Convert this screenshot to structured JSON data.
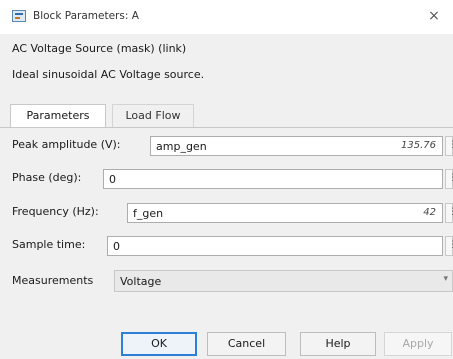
{
  "window": {
    "title": "Block Parameters: A",
    "close_glyph": "×",
    "icon": "simulink-block-icon"
  },
  "header": {
    "mask_title": "AC Voltage Source (mask) (link)",
    "description": "Ideal sinusoidal AC Voltage source."
  },
  "tabs": [
    {
      "label": "Parameters",
      "active": true
    },
    {
      "label": "Load Flow",
      "active": false
    }
  ],
  "params": {
    "peak_amplitude": {
      "label": "Peak amplitude (V):",
      "value": "amp_gen",
      "evaluated": "135.76"
    },
    "phase": {
      "label": "Phase (deg):",
      "value": "0"
    },
    "frequency": {
      "label": "Frequency (Hz):",
      "value": "f_gen",
      "evaluated": "42"
    },
    "sample_time": {
      "label": "Sample time:",
      "value": "0"
    },
    "measurements": {
      "label": "Measurements",
      "value": "Voltage"
    }
  },
  "buttons": {
    "ok": "OK",
    "cancel": "Cancel",
    "help": "Help",
    "apply": "Apply"
  },
  "colors": {
    "accent": "#2e7fd8",
    "panel_bg": "#f0f0f0"
  }
}
